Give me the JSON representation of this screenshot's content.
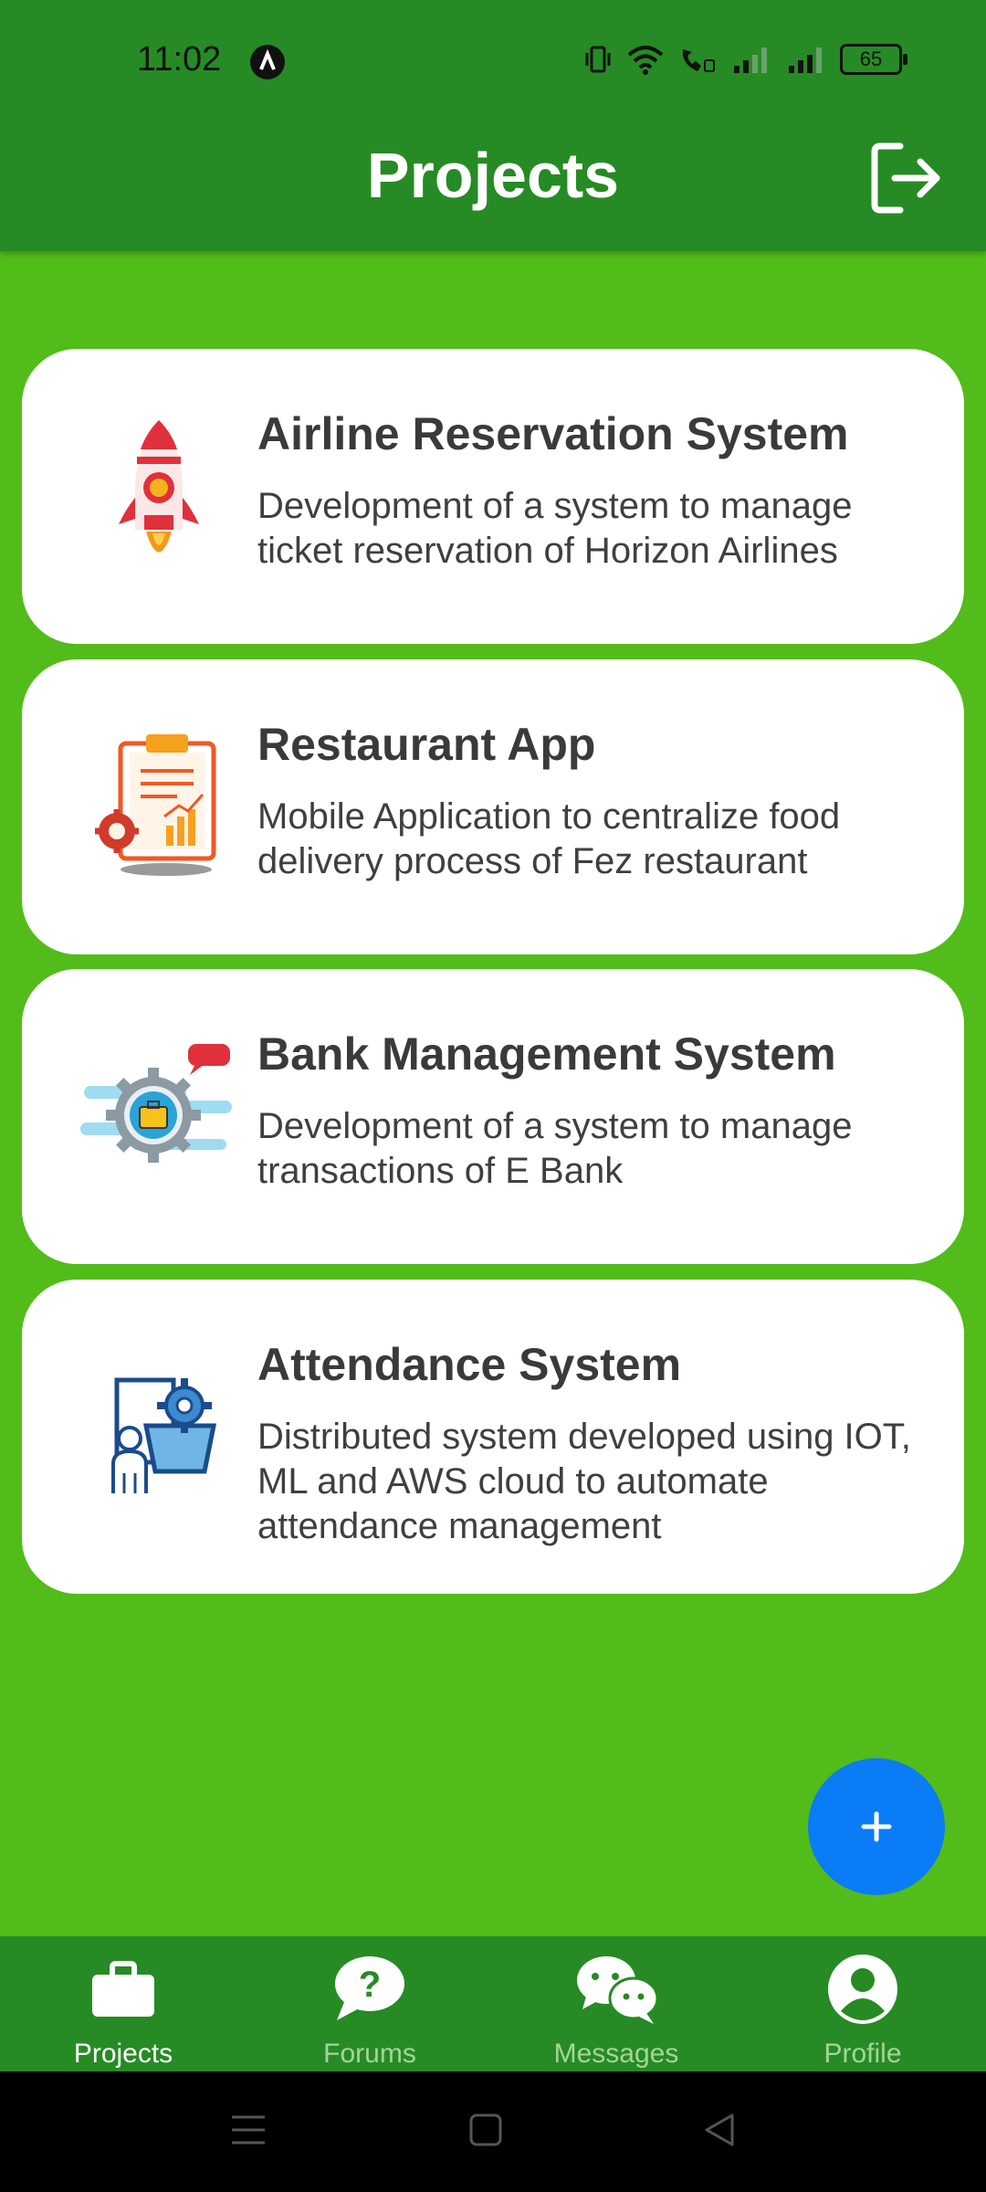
{
  "status_bar": {
    "time": "11:02",
    "battery": "65"
  },
  "app_bar": {
    "title": "Projects"
  },
  "projects": [
    {
      "title": "Airline Reservation System",
      "description": "Development of a system to manage ticket reservation of Horizon Airlines",
      "icon": "rocket-icon"
    },
    {
      "title": "Restaurant App",
      "description": "Mobile Application to centralize food delivery process of Fez restaurant",
      "icon": "clipboard-report-icon"
    },
    {
      "title": "Bank Management System",
      "description": "Development of a system to manage transactions of E Bank",
      "icon": "gear-briefcase-icon"
    },
    {
      "title": "Attendance System",
      "description": "Distributed system developed using IOT, ML and AWS cloud to automate attendance management",
      "icon": "presenter-gear-icon"
    }
  ],
  "fab": {
    "label": "+"
  },
  "bottom_nav": [
    {
      "label": "Projects",
      "icon": "briefcase-icon",
      "active": true
    },
    {
      "label": "Forums",
      "icon": "question-bubble-icon",
      "active": false
    },
    {
      "label": "Messages",
      "icon": "chat-bubbles-icon",
      "active": false
    },
    {
      "label": "Profile",
      "icon": "person-circle-icon",
      "active": false
    }
  ],
  "colors": {
    "header": "#268B24",
    "background": "#52BC1A",
    "fab": "#0A7CF5",
    "nav_active": "#FFFFFF",
    "nav_inactive": "#A6D49A"
  }
}
